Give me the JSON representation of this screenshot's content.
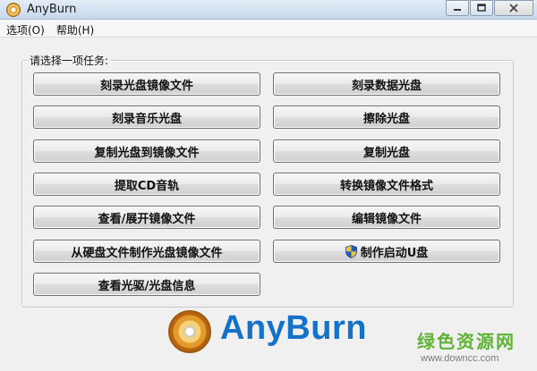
{
  "window": {
    "title": "AnyBurn"
  },
  "menu": {
    "items": [
      "选项(O)",
      "帮助(H)"
    ]
  },
  "task_group": {
    "label": "请选择一项任务:"
  },
  "tasks": [
    "刻录光盘镜像文件",
    "刻录数据光盘",
    "刻录音乐光盘",
    "擦除光盘",
    "复制光盘到镜像文件",
    "复制光盘",
    "提取CD音轨",
    "转换镜像文件格式",
    "查看/展开镜像文件",
    "编辑镜像文件",
    "从硬盘文件制作光盘镜像文件",
    "制作启动U盘",
    "查看光驱/光盘信息"
  ],
  "logo": {
    "text": "AnyBurn",
    "brand_color": "#1672c8"
  },
  "watermark": {
    "name": "绿色资源网",
    "url": "www.downcc.com",
    "color": "#5fb437"
  },
  "icons": {
    "app": "disc-icon",
    "boot_usb": "uac-shield-icon"
  }
}
